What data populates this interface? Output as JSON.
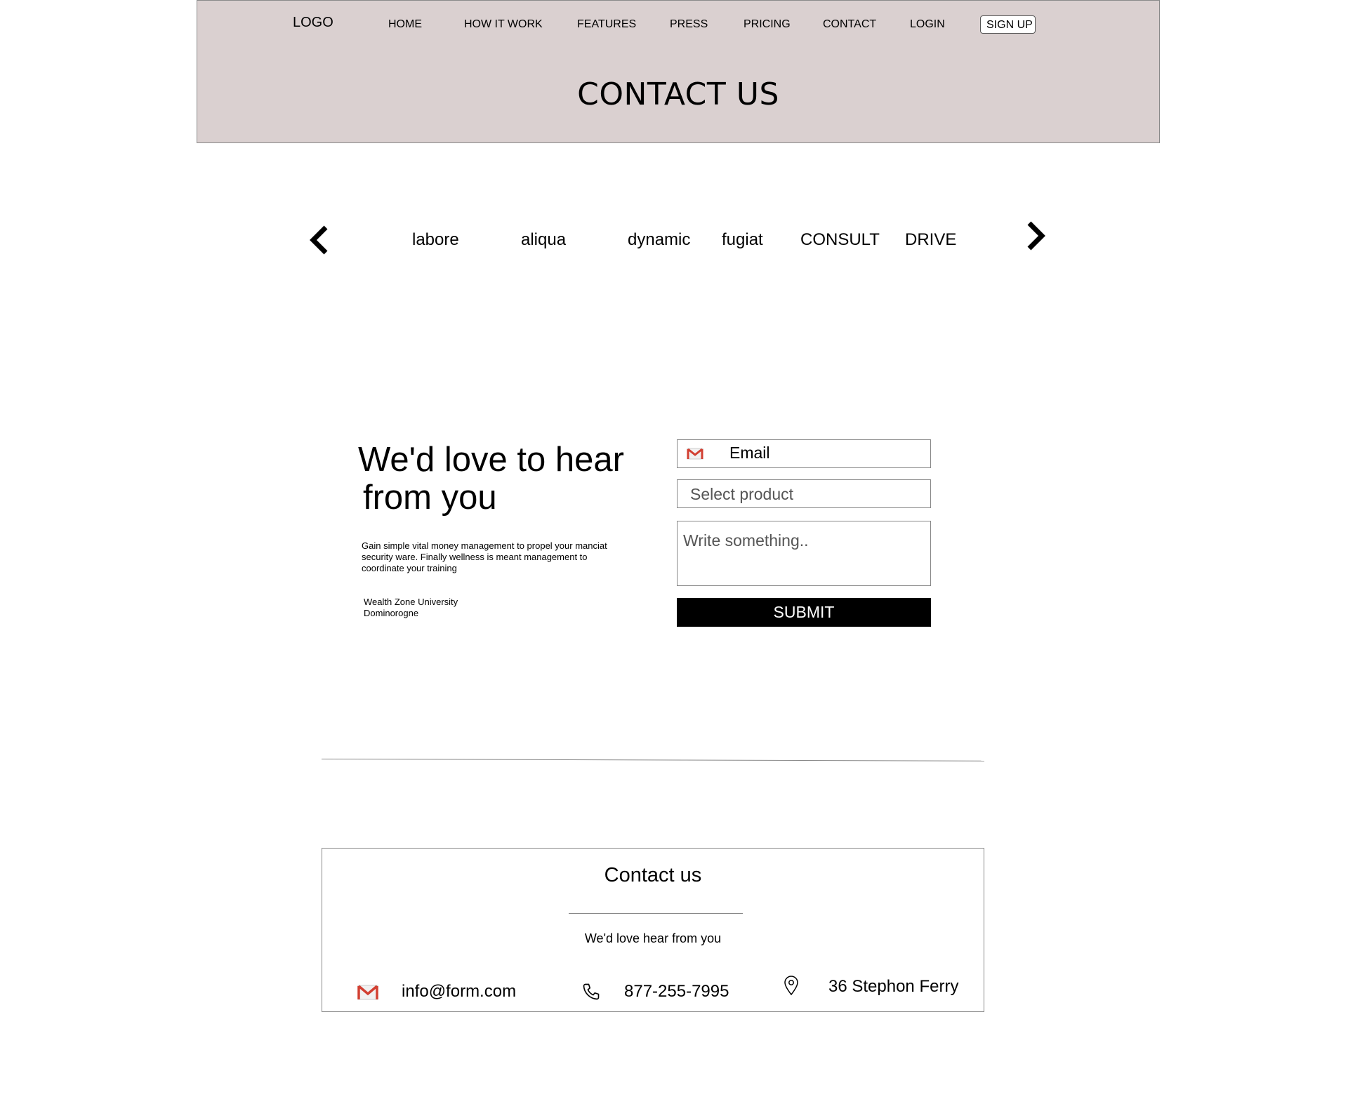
{
  "header": {
    "logo": "LOGO",
    "nav": [
      "HOME",
      "HOW IT WORK",
      "FEATURES",
      "PRESS",
      "PRICING",
      "CONTACT",
      "LOGIN"
    ],
    "signup_label": "SIGN UP",
    "title": "CONTACT US",
    "background_color": "#dad0d0"
  },
  "carousel": {
    "items": [
      "labore",
      "aliqua",
      "dynamic",
      "fugiat",
      "CONSULT",
      "DRIVE"
    ],
    "prev_icon": "chevron-left-icon",
    "next_icon": "chevron-right-icon"
  },
  "intro": {
    "heading_line1": "We'd love to hear",
    "heading_line2": "from you",
    "body_line1": "Gain simple vital money management to propel your manciat",
    "body_line2": "security ware. Finally wellness is meant management to",
    "body_line3": "coordinate your training",
    "address_line1": "Wealth Zone University",
    "address_line2": "Dominorogne"
  },
  "form": {
    "email_placeholder": "Email",
    "product_placeholder": "Select product",
    "message_placeholder": "Write something..",
    "submit_label": "SUBMIT",
    "email_icon": "gmail-icon",
    "submit_color": "#000000"
  },
  "contact": {
    "title": "Contact us",
    "subtitle": "We'd love hear from you",
    "email": "info@form.com",
    "phone": "877-255-7995",
    "address": "36 Stephon Ferry",
    "icons": [
      "gmail-icon",
      "phone-icon",
      "location-pin-icon"
    ]
  }
}
